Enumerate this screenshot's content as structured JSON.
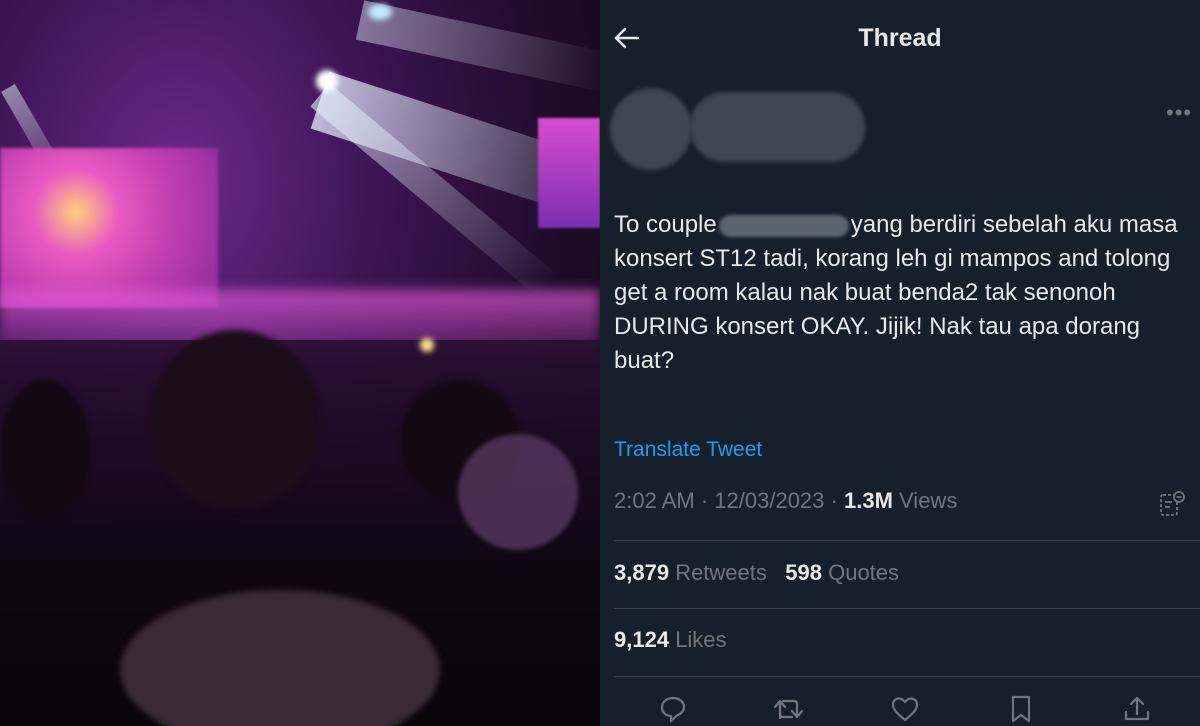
{
  "header": {
    "title": "Thread"
  },
  "tweet": {
    "text_before": "To couple",
    "text_after": "yang berdiri sebelah aku masa konsert ST12 tadi, korang leh gi mampos and tolong get a room kalau nak buat benda2 tak senonoh DURING konsert OKAY. Jijik! Nak tau apa dorang buat?",
    "translate_label": "Translate Tweet",
    "time": "2:02 AM",
    "date": "12/03/2023",
    "views_count": "1.3M",
    "views_label": "Views"
  },
  "stats": {
    "retweets_count": "3,879",
    "retweets_label": "Retweets",
    "quotes_count": "598",
    "quotes_label": "Quotes",
    "likes_count": "9,124",
    "likes_label": "Likes"
  },
  "icons": [
    "back-arrow-icon",
    "more-icon",
    "analytics-icon",
    "reply-icon",
    "retweet-icon",
    "like-icon",
    "bookmark-icon",
    "share-icon"
  ],
  "colors": {
    "background": "#15202b",
    "text": "#e7e9ea",
    "secondary": "#71767b",
    "link": "#1d9bf0",
    "divider": "#38444d"
  }
}
